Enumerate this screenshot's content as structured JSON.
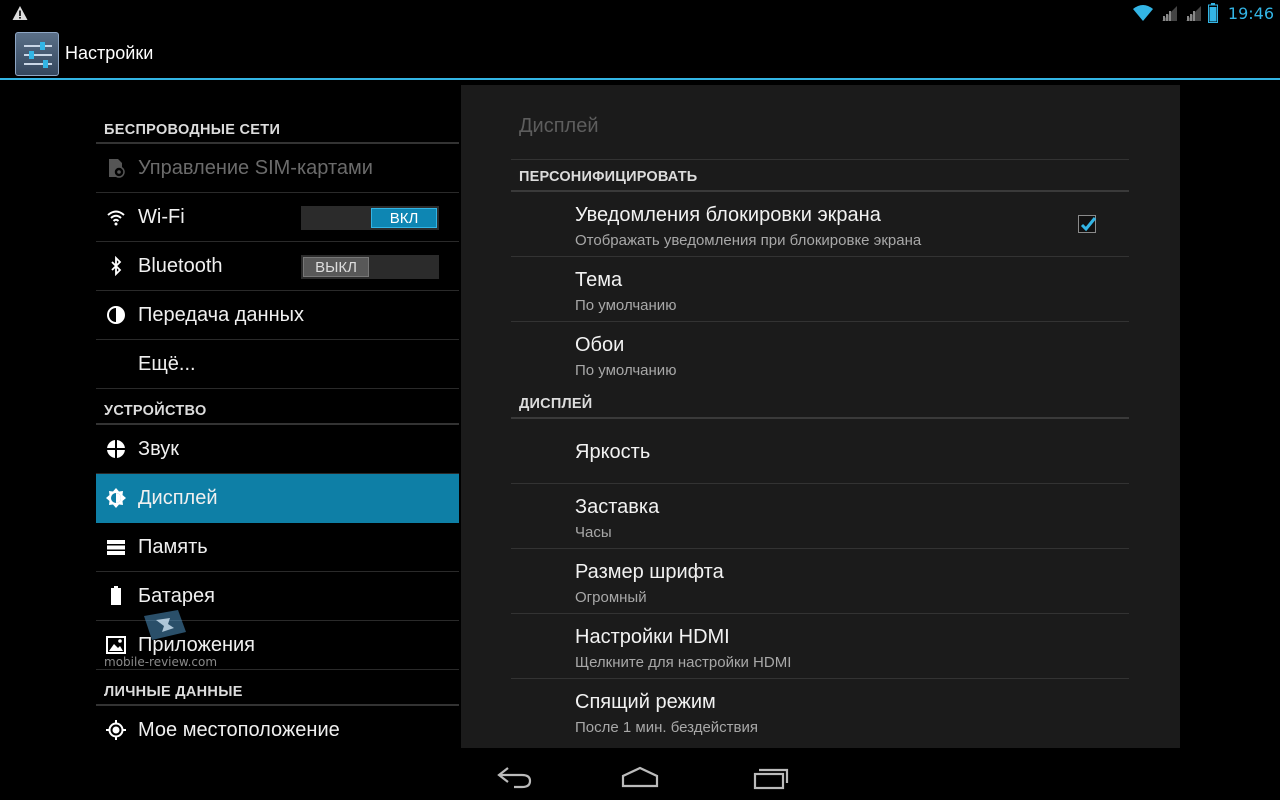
{
  "status_bar": {
    "time": "19:46",
    "icons": [
      "warning-icon",
      "wifi-icon",
      "signal-icon",
      "signal-icon",
      "battery-icon"
    ]
  },
  "action_bar": {
    "title": "Настройки",
    "icon": "settings-sliders-icon"
  },
  "sidebar": {
    "sections": [
      {
        "header": "БЕСПРОВОДНЫЕ СЕТИ",
        "items": [
          {
            "label": "Управление SIM-картами",
            "icon": "sim-icon",
            "disabled": true
          },
          {
            "label": "Wi-Fi",
            "icon": "wifi-icon",
            "toggle": "ВКЛ",
            "toggle_state": "on"
          },
          {
            "label": "Bluetooth",
            "icon": "bluetooth-icon",
            "toggle": "ВЫКЛ",
            "toggle_state": "off"
          },
          {
            "label": "Передача данных",
            "icon": "data-usage-icon"
          },
          {
            "label": "Ещё...",
            "icon": ""
          }
        ]
      },
      {
        "header": "УСТРОЙСТВО",
        "items": [
          {
            "label": "Звук",
            "icon": "sound-icon"
          },
          {
            "label": "Дисплей",
            "icon": "display-icon",
            "selected": true
          },
          {
            "label": "Память",
            "icon": "storage-icon"
          },
          {
            "label": "Батарея",
            "icon": "battery-icon"
          },
          {
            "label": "Приложения",
            "icon": "apps-icon"
          }
        ]
      },
      {
        "header": "ЛИЧНЫЕ ДАННЫЕ",
        "items": [
          {
            "label": "Мое местоположение",
            "icon": "location-icon"
          }
        ]
      }
    ],
    "watermark": "mobile-review.com"
  },
  "detail": {
    "title": "Дисплей",
    "sections": [
      {
        "header": "ПЕРСОНИФИЦИРОВАТЬ",
        "items": [
          {
            "title": "Уведомления блокировки экрана",
            "summary": "Отображать уведомления при блокировке экрана",
            "checked": true
          },
          {
            "title": "Тема",
            "summary": "По умолчанию"
          },
          {
            "title": "Обои",
            "summary": "По умолчанию"
          }
        ]
      },
      {
        "header": "ДИСПЛЕЙ",
        "items": [
          {
            "title": "Яркость",
            "summary": ""
          },
          {
            "title": "Заставка",
            "summary": "Часы"
          },
          {
            "title": "Размер шрифта",
            "summary": "Огромный"
          },
          {
            "title": "Настройки HDMI",
            "summary": "Щелкните для настройки HDMI"
          },
          {
            "title": "Спящий режим",
            "summary": "После 1 мин. бездействия"
          }
        ]
      }
    ]
  },
  "colors": {
    "accent": "#33b5e5",
    "selected": "#0e7fa6",
    "pane_bg": "#1b1b1b"
  },
  "nav_bar": {
    "buttons": [
      "back-icon",
      "home-icon",
      "recents-icon"
    ]
  }
}
